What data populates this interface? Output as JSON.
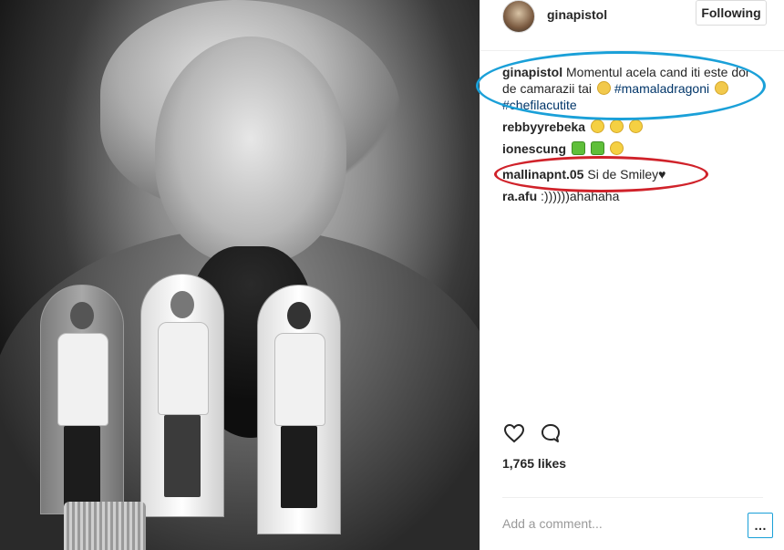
{
  "post": {
    "username": "ginapistol",
    "follow_label": "Following",
    "caption": {
      "user": "ginapistol",
      "text": "Momentul acela cand iti este dor de camarazii tai",
      "hashtag1": "#mamaladragoni",
      "hashtag2": "#chefilacutite"
    },
    "comments": [
      {
        "user": "rebbyyrebeka",
        "text": ""
      },
      {
        "user": "ionescung",
        "text": ""
      },
      {
        "user": "mallinapnt.05",
        "text": "Si de Smiley♥"
      },
      {
        "user": "ra.afu",
        "text": ":))))))ahahaha"
      }
    ],
    "likes": "1,765 likes",
    "add_comment_placeholder": "Add a comment...",
    "more_label": "…"
  },
  "icons": {
    "like": "heart-icon",
    "comment": "comment-bubble-icon",
    "more": "more-options-icon"
  },
  "colors": {
    "annotation_blue": "#1aa0d8",
    "annotation_red": "#d0222a",
    "hashtag": "#003569"
  }
}
